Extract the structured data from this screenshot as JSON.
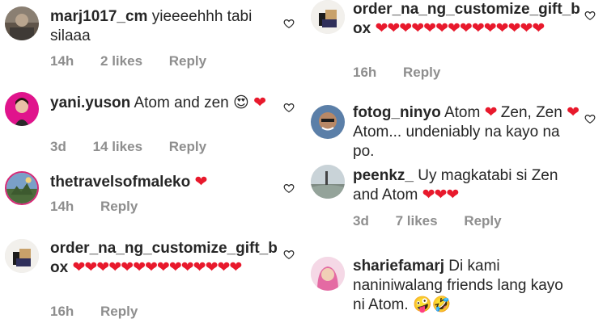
{
  "comments": [
    {
      "username": "marj1017_cm",
      "text": "yieeeehhh tabi silaaa",
      "hearts": "",
      "emoji": "",
      "time": "14h",
      "likes": "2 likes",
      "reply": "Reply"
    },
    {
      "username": "yani.yuson",
      "text": "Atom and zen 😍",
      "hearts": "❤",
      "emoji": "",
      "time": "3d",
      "likes": "14 likes",
      "reply": "Reply"
    },
    {
      "username": "thetravelsofmaleko",
      "text": "",
      "hearts": "❤",
      "emoji": "",
      "time": "14h",
      "likes": "",
      "reply": "Reply"
    },
    {
      "username": "order_na_ng_customize_gift_b ox",
      "text": "",
      "hearts": "❤❤❤❤❤❤❤❤❤❤❤❤❤❤",
      "emoji": "",
      "time": "16h",
      "likes": "",
      "reply": "Reply"
    },
    {
      "username": "order_na_ng_customize_gift_b ox",
      "text": "",
      "hearts": "❤❤❤❤❤❤❤❤❤❤❤❤❤❤",
      "emoji": "",
      "time": "16h",
      "likes": "",
      "reply": "Reply"
    },
    {
      "username": "fotog_ninyo",
      "text_a": "Atom",
      "heart_a": "❤",
      "text_b": "Zen, Zen",
      "heart_b": "❤",
      "text_c": "Atom... undeniably na kayo na po.",
      "time": "",
      "likes": "",
      "reply": ""
    },
    {
      "username": "peenkz_",
      "text": "Uy magkatabi si Zen and Atom",
      "hearts": "❤❤❤",
      "emoji": "",
      "time": "3d",
      "likes": "7 likes",
      "reply": "Reply"
    },
    {
      "username": "shariefamarj",
      "text": "Di kami naniniwalang friends lang kayo ni Atom.",
      "hearts": "",
      "emoji": "🤪🤣",
      "time": "",
      "likes": "",
      "reply": ""
    }
  ]
}
